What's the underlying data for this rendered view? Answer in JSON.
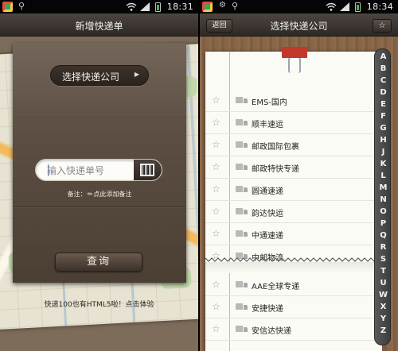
{
  "left_screen": {
    "status_bar": {
      "time": "18:31"
    },
    "title": "新增快递单",
    "choose_company_label": "选择快递公司",
    "tracking_input": {
      "placeholder": "输入快递单号",
      "value": ""
    },
    "remark": {
      "prefix": "备注：",
      "link": "点此添加备注"
    },
    "query_button_label": "查询",
    "promo_text": "快递100也有HTML5啦！点击体验",
    "icons": [
      "app-icon",
      "usb-icon",
      "wifi-icon",
      "signal-icon",
      "battery-icon",
      "chevron-right-icon",
      "barcode-icon",
      "pencil-icon"
    ]
  },
  "right_screen": {
    "status_bar": {
      "time": "18:34"
    },
    "title": "选择快递公司",
    "back_label": "返回",
    "star_label": "☆",
    "favorites": [
      {
        "name": "EMS-国内"
      },
      {
        "name": "顺丰速运"
      },
      {
        "name": "邮政国际包裹"
      },
      {
        "name": "邮政特快专递"
      },
      {
        "name": "圆通速递"
      },
      {
        "name": "韵达快运"
      },
      {
        "name": "中通速递"
      },
      {
        "name": "中邮物流"
      }
    ],
    "companies": [
      {
        "name": "AAE全球专递"
      },
      {
        "name": "安捷快递"
      },
      {
        "name": "安信达快递"
      }
    ],
    "alphabet": [
      "A",
      "B",
      "C",
      "D",
      "E",
      "F",
      "G",
      "H",
      "J",
      "K",
      "L",
      "M",
      "N",
      "O",
      "P",
      "Q",
      "R",
      "S",
      "T",
      "U",
      "W",
      "X",
      "Y",
      "Z"
    ],
    "icons": [
      "star-icon",
      "truck-icon",
      "binder-clip-icon"
    ]
  },
  "colors": {
    "titlebar": "#3a332e",
    "envelope": "#5a4c40",
    "paper": "#fbfbf6",
    "index_bar": "#4a4a4a",
    "clip": "#c0392b"
  }
}
